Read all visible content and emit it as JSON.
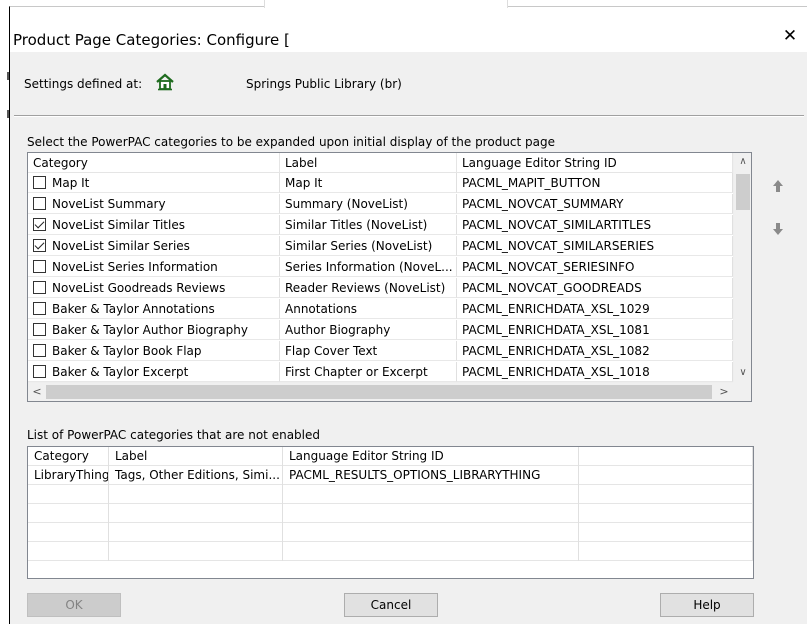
{
  "window": {
    "title": "Product Page Categories: Configure [",
    "close_glyph": "✕"
  },
  "settings": {
    "label": "Settings defined at:",
    "icon": "library-home-icon",
    "value": "Springs Public Library (br)"
  },
  "expanded_grid": {
    "caption": "Select the PowerPAC categories to be expanded upon initial display of the product page",
    "columns": [
      "Category",
      "Label",
      "Language Editor String ID"
    ],
    "rows": [
      {
        "checked": false,
        "category": "Map It",
        "label": "Map It",
        "string_id": "PACML_MAPIT_BUTTON"
      },
      {
        "checked": false,
        "category": "NoveList Summary",
        "label": "Summary (NoveList)",
        "string_id": "PACML_NOVCAT_SUMMARY"
      },
      {
        "checked": true,
        "category": "NoveList Similar Titles",
        "label": "Similar Titles (NoveList)",
        "string_id": "PACML_NOVCAT_SIMILARTITLES"
      },
      {
        "checked": true,
        "category": "NoveList Similar Series",
        "label": "Similar Series (NoveList)",
        "string_id": "PACML_NOVCAT_SIMILARSERIES"
      },
      {
        "checked": false,
        "category": "NoveList Series Information",
        "label": "Series Information (NoveL...",
        "string_id": "PACML_NOVCAT_SERIESINFO"
      },
      {
        "checked": false,
        "category": "NoveList Goodreads Reviews",
        "label": "Reader Reviews (NoveList)",
        "string_id": "PACML_NOVCAT_GOODREADS"
      },
      {
        "checked": false,
        "category": "Baker & Taylor Annotations",
        "label": "Annotations",
        "string_id": "PACML_ENRICHDATA_XSL_1029"
      },
      {
        "checked": false,
        "category": "Baker & Taylor Author Biography",
        "label": "Author Biography",
        "string_id": "PACML_ENRICHDATA_XSL_1081"
      },
      {
        "checked": false,
        "category": "Baker & Taylor Book Flap",
        "label": "Flap Cover Text",
        "string_id": "PACML_ENRICHDATA_XSL_1082"
      },
      {
        "checked": false,
        "category": "Baker & Taylor Excerpt",
        "label": "First Chapter or Excerpt",
        "string_id": "PACML_ENRICHDATA_XSL_1018"
      }
    ]
  },
  "side_buttons": {
    "up_icon": "arrow-up-icon",
    "down_icon": "arrow-down-icon"
  },
  "disabled_grid": {
    "caption": "List of PowerPAC categories that are not enabled",
    "columns": [
      "Category",
      "Label",
      "Language Editor String ID",
      ""
    ],
    "rows": [
      {
        "category": "LibraryThing",
        "label": "Tags, Other Editions, Simi...",
        "string_id": "PACML_RESULTS_OPTIONS_LIBRARYTHING",
        "extra": ""
      }
    ],
    "empty_rows": 4
  },
  "buttons": {
    "ok": "OK",
    "cancel": "Cancel",
    "help": "Help"
  },
  "colors": {
    "dialog_bg": "#f0f0f0",
    "house_icon": "#1e6b1e"
  }
}
